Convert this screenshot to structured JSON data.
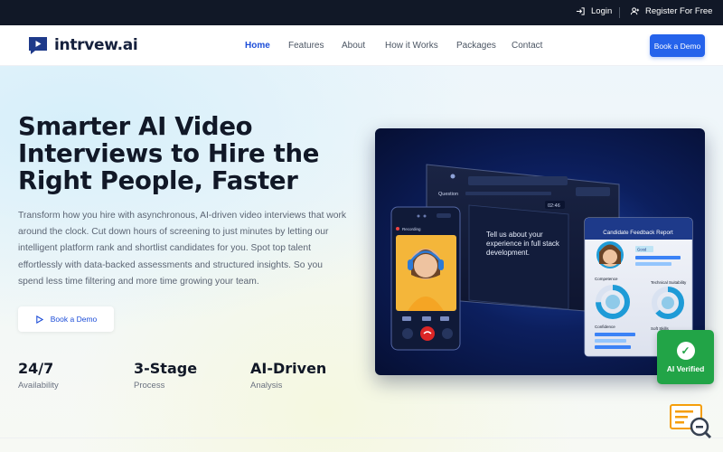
{
  "topbar": {
    "login": "Login",
    "register": "Register For Free"
  },
  "nav": {
    "brand": "intrvew.ai",
    "items": [
      "Home",
      "Features",
      "About",
      "How it Works",
      "Packages",
      "Contact"
    ],
    "demo_button": "Book a Demo"
  },
  "hero": {
    "heading": "Smarter AI Video Interviews to Hire the Right People, Faster",
    "description": "Transform how you hire with asynchronous, AI-driven video interviews that work around the clock. Cut down hours of screening to just minutes by letting our intelligent platform rank and shortlist candidates for you. Spot top talent effortlessly with data-backed assessments and structured insights. So you spend less time filtering and more time growing your team.",
    "cta": "Book a Demo",
    "stats": [
      {
        "value": "24/7",
        "label": "Availability"
      },
      {
        "value": "3-Stage",
        "label": "Process"
      },
      {
        "value": "AI-Driven",
        "label": "Analysis"
      }
    ]
  },
  "illustration": {
    "question_label": "Question",
    "timer": "02:46",
    "question_text": "Tell us about your experience in full stack development.",
    "recording": "Recording",
    "report_title": "Candidate Feedback Report",
    "good_badge": "Good",
    "metrics": [
      "Competence",
      "Technical Suitability",
      "Confidence",
      "Soft Skills"
    ]
  },
  "badge": {
    "verified": "AI Verified"
  },
  "colors": {
    "primary": "#2563eb",
    "dark": "#111827",
    "success": "#22a447",
    "accent_orange": "#f59e0b"
  }
}
